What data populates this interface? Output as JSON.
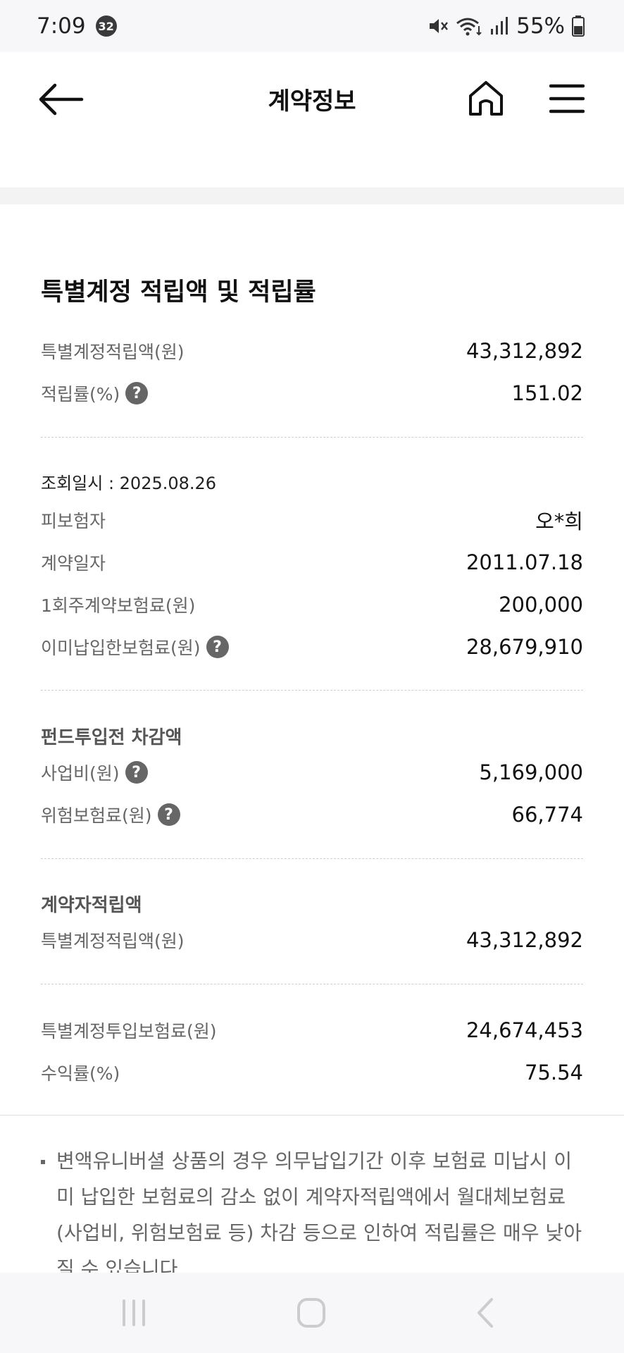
{
  "status": {
    "time": "7:09",
    "notif_count": "32",
    "battery": "55%"
  },
  "header": {
    "title": "계약정보",
    "icons": [
      "back-arrow-icon",
      "home-icon",
      "hamburger-menu-icon"
    ]
  },
  "section1": {
    "title": "특별계정 적립액 및 적립률",
    "rows": [
      {
        "label": "특별계정적립액(원)",
        "value": "43,312,892"
      },
      {
        "label": "적립률(%)",
        "value": "151.02"
      }
    ]
  },
  "inquiry_date": "조회일시 : 2025.08.26",
  "info_rows": [
    {
      "label": "피보험자",
      "value": "오*희"
    },
    {
      "label": "계약일자",
      "value": "2011.07.18"
    },
    {
      "label": "1회주계약보험료(원)",
      "value": "200,000"
    },
    {
      "label": "이미납입한보험료(원)",
      "value": "28,679,910"
    }
  ],
  "deduction": {
    "title": "펀드투입전 차감액",
    "rows": [
      {
        "label": "사업비(원)",
        "value": "5,169,000"
      },
      {
        "label": "위험보험료(원)",
        "value": "66,774"
      }
    ]
  },
  "contractor": {
    "title": "계약자적립액",
    "rows": [
      {
        "label": "특별계정적립액(원)",
        "value": "43,312,892"
      }
    ]
  },
  "returns": {
    "rows": [
      {
        "label": "특별계정투입보험료(원)",
        "value": "24,674,453"
      },
      {
        "label": "수익률(%)",
        "value": "75.54"
      }
    ]
  },
  "notice": "변액유니버셜 상품의 경우 의무납입기간 이후 보험료 미납시 이미 납입한 보험료의 감소 없이 계약자적립액에서 월대체보험료(사업비, 위험보험료 등) 차감 등으로 인하여 적립률은 매우 낮아질 수 있습니다.",
  "help_symbol": "?"
}
